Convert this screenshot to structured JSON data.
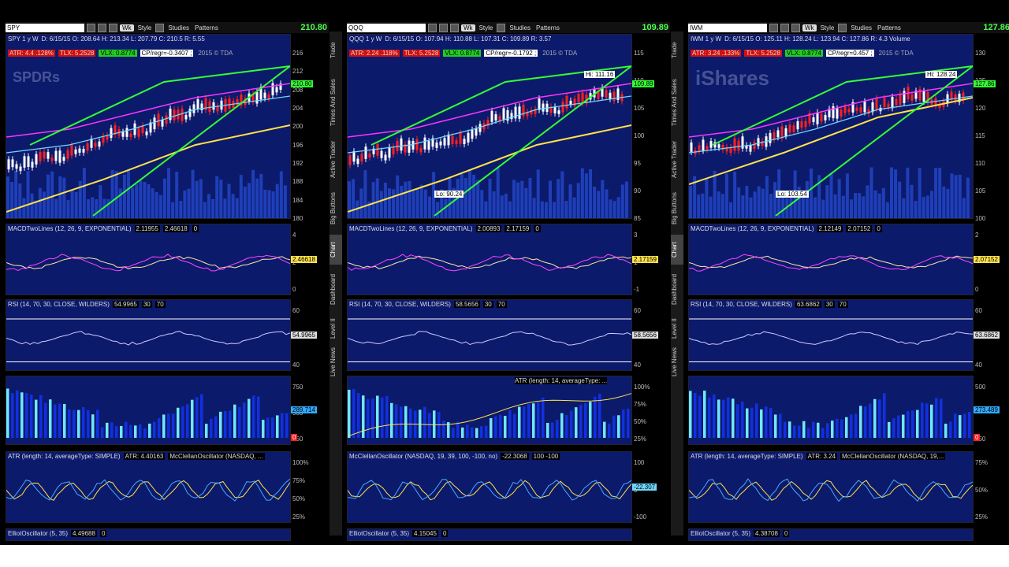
{
  "panels": [
    {
      "symbol": "SPY",
      "price": "210.80",
      "toolbar": {
        "wk": "Wk",
        "style": "Style",
        "studies": "Studies",
        "patterns": "Patterns"
      },
      "header": "SPY 1 y W",
      "ohlc": "D: 6/15/15   O: 208.64   H: 213.34   L: 207.79   C: 210.5   R: 5.55",
      "atr_tag": "ATR: 4.4  .128%",
      "tlx_tag": "TLX: 5.2528",
      "vlx_tag": "VLX: 0.8774",
      "cp_tag": "CP/regr=-0.3407 ;",
      "watermark": "SPDRs",
      "copyright": "2015 © TDA",
      "price_axis": [
        "216",
        "212",
        "208",
        "204",
        "200",
        "196",
        "192",
        "188",
        "184",
        "180"
      ],
      "macd_label": "MACDTwoLines (12, 26, 9, EXPONENTIAL)",
      "macd_v1": "2.11955",
      "macd_v2": "2.46618",
      "macd_v3": "0",
      "macd_axis": [
        "4",
        "2",
        "0"
      ],
      "macd_box": "2.46618",
      "rsi_label": "RSI (14, 70, 30, CLOSE, WILDERS)",
      "rsi_v1": "54.9965",
      "rsi_v2": "30",
      "rsi_v3": "70",
      "rsi_axis": [
        "60",
        "40"
      ],
      "rsi_box": "54.9965",
      "hist_axis": [
        "750",
        "500",
        "250"
      ],
      "hist_box": "289.714",
      "hist_zero": "0",
      "ind4_label": "ATR (length: 14, averageType: SIMPLE)",
      "ind4_v1": "ATR: 4.40163",
      "ind4_v2": "McClellanOscillator (NASDAQ, ...",
      "ind4_axis": [
        "100%",
        "75%",
        "50%",
        "25%"
      ],
      "ell_label": "ElliotOscillator (5, 35)",
      "ell_v1": "4.49688",
      "ell_v2": "0"
    },
    {
      "symbol": "QQQ",
      "price": "109.89",
      "toolbar": {
        "wk": "Wk",
        "style": "Style",
        "studies": "Studies",
        "patterns": "Patterns"
      },
      "header": "QQQ 1 y W",
      "ohlc": "D: 6/15/15   O: 107.94   H: 110.88   L: 107.31   C: 109.89   R: 3.57",
      "atr_tag": "ATR: 2.24  .118%",
      "tlx_tag": "TLX: 5.2528",
      "vlx_tag": "VLX: 0.8774",
      "cp_tag": "CP/regr=-0.1792 ;",
      "watermark": "",
      "copyright": "2015 © TDA",
      "hi_label": "Hi: 111.16",
      "lo_label": "Lo: 90.24",
      "price_axis": [
        "115",
        "110",
        "105",
        "100",
        "95",
        "90",
        "85"
      ],
      "macd_label": "MACDTwoLines (12, 26, 9, EXPONENTIAL)",
      "macd_v1": "2.00893",
      "macd_v2": "2.17159",
      "macd_v3": "0",
      "macd_axis": [
        "3",
        "1",
        "-1"
      ],
      "macd_box": "2.17159",
      "rsi_label": "RSI (14, 70, 30, CLOSE, WILDERS)",
      "rsi_v1": "58.5656",
      "rsi_v2": "30",
      "rsi_v3": "70",
      "rsi_axis": [
        "60",
        "40"
      ],
      "rsi_box": "58.5656",
      "hist_extra": "ATR (length: 14, averageType: ...",
      "hist_axis": [
        "100%",
        "75%",
        "50%",
        "25%"
      ],
      "hist_box": "",
      "hist_zero": "",
      "ind4_label": "McClellanOscillator (NASDAQ, 19, 39, 100, -100, no)",
      "ind4_v1": "-22.3068",
      "ind4_v2": "100  -100",
      "ind4_axis": [
        "100",
        "0",
        "-100"
      ],
      "ind4_box": "-22.307",
      "ell_label": "ElliotOscillator (5, 35)",
      "ell_v1": "4.15045",
      "ell_v2": "0"
    },
    {
      "symbol": "IWM",
      "price": "127.86",
      "toolbar": {
        "wk": "Wk",
        "style": "Style",
        "studies": "Studies",
        "patterns": "Patterns"
      },
      "header": "IWM 1 y W",
      "ohlc": "D: 6/15/15   O: 125.11   H: 128.24   L: 123.94   C: 127.86   R: 4.3   Volume",
      "atr_tag": "ATR: 3.24  .133%",
      "tlx_tag": "TLX: 5.2528",
      "vlx_tag": "VLX: 0.8774",
      "cp_tag": "CP/regr=0.457 ;",
      "watermark": "iShares",
      "copyright": "2015 © TDA",
      "hi_label": "Hi: 128.24",
      "lo_label": "Lo: 103.54",
      "price_axis": [
        "130",
        "125",
        "120",
        "115",
        "110",
        "105",
        "100"
      ],
      "macd_label": "MACDTwoLines (12, 26, 9, EXPONENTIAL)",
      "macd_v1": "2.12149",
      "macd_v2": "2.07152",
      "macd_v3": "0",
      "macd_axis": [
        "2",
        "0"
      ],
      "macd_box": "2.07152",
      "rsi_label": "RSI (14, 70, 30, CLOSE, WILDERS)",
      "rsi_v1": "63.6862",
      "rsi_v2": "30",
      "rsi_v3": "70",
      "rsi_axis": [
        "60",
        "40"
      ],
      "rsi_box": "63.6862",
      "hist_axis": [
        "500",
        "250"
      ],
      "hist_box": "273.489",
      "hist_zero": "0",
      "ind4_label": "ATR (length: 14, averageType: SIMPLE)",
      "ind4_v1": "ATR: 3.24",
      "ind4_v2": "McClellanOscillator (NASDAQ, 19,...",
      "ind4_axis": [
        "75%",
        "50%",
        "25%"
      ],
      "ell_label": "ElliotOscillator (5, 35)",
      "ell_v1": "4.38708",
      "ell_v2": "0"
    }
  ],
  "side_tabs": [
    "Trade",
    "Times And Sales",
    "Active Trader",
    "Big Buttons",
    "Chart",
    "Dashboard",
    "Level II",
    "Live News"
  ],
  "colors": {
    "panel_bg": "#0c1a6b",
    "up": "#ffffff",
    "down": "#ff2020",
    "green_line": "#33ff33",
    "magenta": "#ff33ff",
    "yellow": "#ffe24a",
    "cyan": "#6fd8ff"
  }
}
